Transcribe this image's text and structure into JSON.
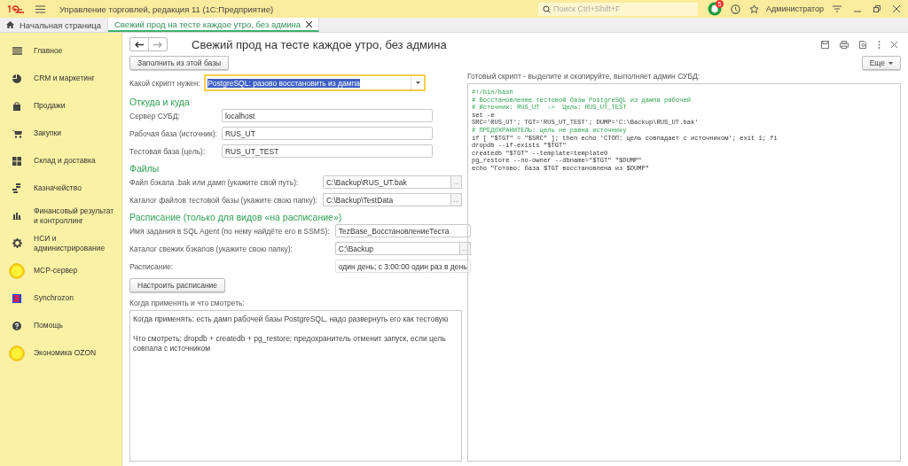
{
  "app": {
    "title": "Управление торговлей, редакция 11  (1С:Предприятие)",
    "search_placeholder": "Поиск Ctrl+Shift+F",
    "notifications": "5",
    "user": "Администратор"
  },
  "tabs": [
    {
      "label": "Начальная страница",
      "kind": "home",
      "selected": false
    },
    {
      "label": "Свежий прод на тесте каждое утро, без админа",
      "kind": "form",
      "selected": true
    }
  ],
  "sidebar": {
    "items": [
      {
        "label": "Главное"
      },
      {
        "label": "CRM и маркетинг"
      },
      {
        "label": "Продажи"
      },
      {
        "label": "Закупки"
      },
      {
        "label": "Склад и доставка"
      },
      {
        "label": "Казначейство"
      },
      {
        "label": "Финансовый результат и контроллинг"
      },
      {
        "label": "НСИ и администрирование"
      },
      {
        "label": "MCP-сервер"
      },
      {
        "label": "Synchrozon"
      },
      {
        "label": "Помощь"
      },
      {
        "label": "Экономика OZON"
      }
    ]
  },
  "form": {
    "title": "Свежий прод на тесте каждое утро, без админа",
    "fill_button": "Заполнить из этой базы",
    "more_button": "Еще",
    "script_select": {
      "label": "Какой скрипт нужен:",
      "value": "PostgreSQL: разово восстановить из дампа"
    },
    "sections": [
      {
        "heading": "Откуда и куда",
        "fields": [
          {
            "label": "Сервер СУБД:",
            "value": "localhost",
            "kind": "text"
          },
          {
            "label": "Рабочая база (источник):",
            "value": "RUS_UT",
            "kind": "text"
          },
          {
            "label": "Тестовая база (цель):",
            "value": "RUS_UT_TEST",
            "kind": "text"
          }
        ]
      },
      {
        "heading": "Файлы",
        "fields": [
          {
            "label": "Файл бэкапа .bak или дамп (укажите свой путь):",
            "value": "C:\\Backup\\RUS_UT.bak",
            "kind": "picker",
            "button": "..."
          },
          {
            "label": "Каталог файлов тестовой базы (укажите свою папку):",
            "value": "C:\\Backup\\TestData",
            "kind": "picker",
            "button": "..."
          }
        ]
      },
      {
        "heading": "Расписание (только для видов «на расписание»)",
        "fields": [
          {
            "label": "Имя задания в SQL Agent (по нему найдёте его в SSMS):",
            "value": "TezBase_ВосстановлениеТеста",
            "kind": "text"
          },
          {
            "label": "Каталог свежих бэкапов (укажите свою папку):",
            "value": "C:\\Backup",
            "kind": "picker",
            "button": "..."
          },
          {
            "label": "Расписание:",
            "value": "один день; с 3:00:00 один раз в день",
            "kind": "readonly"
          }
        ]
      }
    ],
    "schedule_button": "Настроить расписание",
    "notes": {
      "label": "Когда применять и что смотреть:",
      "paragraphs": [
        "Когда применять: есть дамп рабочей базы PostgreSQL, надо развернуть его как тестовую",
        "Что смотреть: dropdb + createdb + pg_restore; предохранитель отменит запуск, если цель совпала с источником"
      ]
    },
    "script": {
      "label": "Готовый скрипт - выделите и скопируйте, выполняет админ СУБД:",
      "lines": [
        {
          "text": "#!/bin/bash",
          "kind": "comment"
        },
        {
          "text": "# Восстановление тестовой базы PostgreSQL из дампа рабочей",
          "kind": "comment"
        },
        {
          "text": "# Источник: RUS_UT  ->  Цель: RUS_UT_TEST",
          "kind": "comment"
        },
        {
          "text": "set -e",
          "kind": "code"
        },
        {
          "text": "SRC='RUS_UT'; TGT='RUS_UT_TEST'; DUMP='C:\\Backup\\RUS_UT.bak'",
          "kind": "code"
        },
        {
          "text": "# ПРЕДОХРАНИТЕЛЬ: цель не равна источнику",
          "kind": "comment"
        },
        {
          "text": "if [ \"$TGT\" = \"$SRC\" ]; then echo 'СТОП: цель совпадает с источником'; exit 1; fi",
          "kind": "code"
        },
        {
          "text": "dropdb --if-exists \"$TGT\"",
          "kind": "code"
        },
        {
          "text": "createdb \"$TGT\" --template=template0",
          "kind": "code"
        },
        {
          "text": "pg_restore --no-owner --dbname=\"$TGT\" \"$DUMP\"",
          "kind": "code"
        },
        {
          "text": "echo \"Готово: база $TGT восстановлена из $DUMP\"",
          "kind": "code"
        }
      ]
    }
  }
}
